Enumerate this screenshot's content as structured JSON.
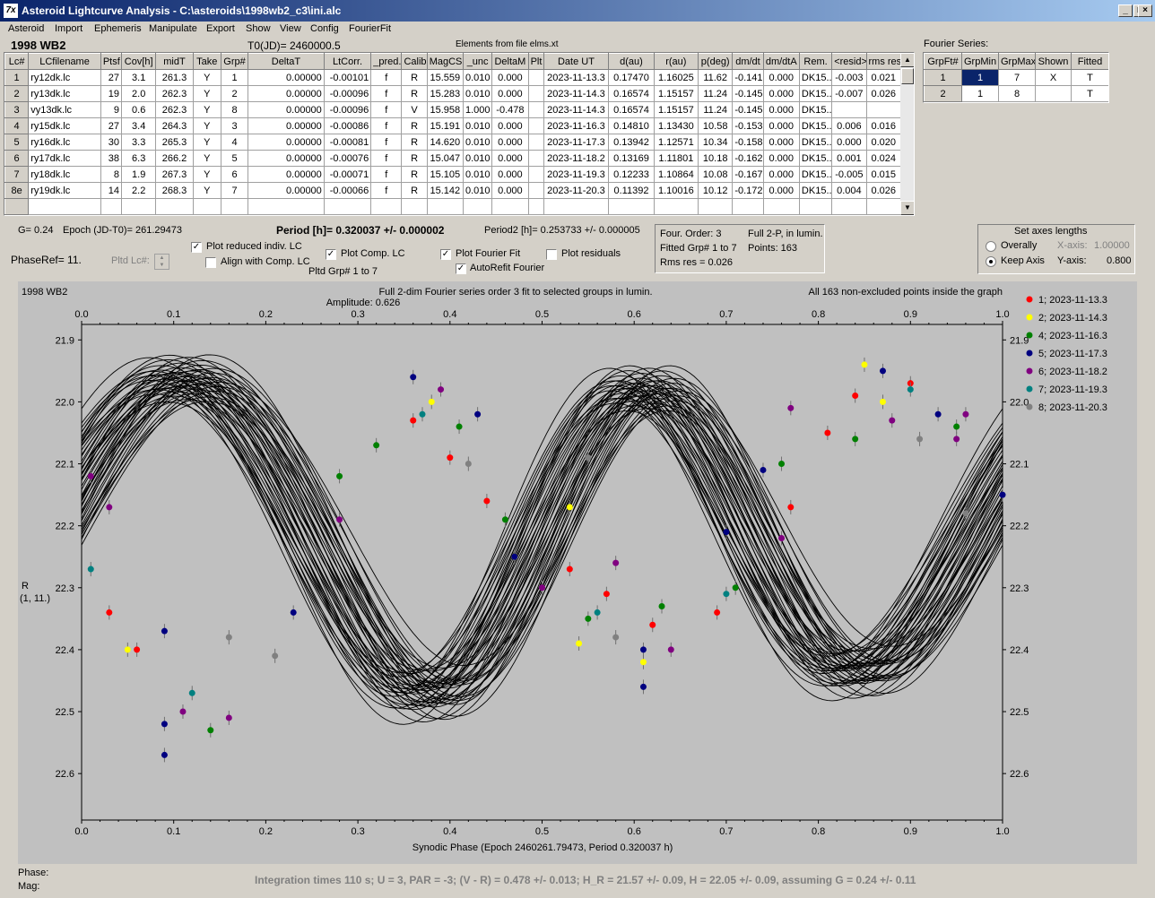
{
  "window": {
    "title": "Asteroid Lightcurve Analysis - C:\\asteroids\\1998wb2_c3\\ini.alc",
    "app_icon": "7x"
  },
  "menu": [
    "Asteroid",
    "Import",
    "Ephemeris",
    "Manipulate",
    "Export",
    "Show",
    "View",
    "Config",
    "FourierFit"
  ],
  "header": {
    "asteroid": "1998 WB2",
    "t0": "T0(JD)= 2460000.5",
    "elements": "Elements from file elms.xt",
    "fourier_label": "Fourier Series:"
  },
  "lc_table": {
    "columns": [
      "Lc#",
      "LCfilename",
      "Ptsf",
      "Cov[h]",
      "midT",
      "Take",
      "Grp#",
      "DeltaT",
      "LtCorr.",
      "_pred.",
      "Calib.",
      "MagCS",
      "_unc",
      "DeltaM",
      "Plt",
      "Date UT",
      "d(au)",
      "r(au)",
      "p(deg)",
      "dm/dt",
      "dm/dtA",
      "Rem.",
      "<resid>",
      "rms res"
    ],
    "rows": [
      [
        "1",
        "ry12dk.lc",
        "27",
        "3.1",
        "261.3",
        "Y",
        "1",
        "0.00000",
        "-0.00101",
        "f",
        "R",
        "15.559",
        "0.010",
        "0.000",
        "",
        "2023-11-13.3",
        "0.17470",
        "1.16025",
        "11.62",
        "-0.141",
        "0.000",
        "DK15...",
        "-0.003",
        "0.021"
      ],
      [
        "2",
        "ry13dk.lc",
        "19",
        "2.0",
        "262.3",
        "Y",
        "2",
        "0.00000",
        "-0.00096",
        "f",
        "R",
        "15.283",
        "0.010",
        "0.000",
        "",
        "2023-11-14.3",
        "0.16574",
        "1.15157",
        "11.24",
        "-0.145",
        "0.000",
        "DK15...",
        "-0.007",
        "0.026"
      ],
      [
        "3",
        "vy13dk.lc",
        "9",
        "0.6",
        "262.3",
        "Y",
        "8",
        "0.00000",
        "-0.00096",
        "f",
        "V",
        "15.958",
        "1.000",
        "-0.478",
        "",
        "2023-11-14.3",
        "0.16574",
        "1.15157",
        "11.24",
        "-0.145",
        "0.000",
        "DK15...",
        "",
        ""
      ],
      [
        "4",
        "ry15dk.lc",
        "27",
        "3.4",
        "264.3",
        "Y",
        "3",
        "0.00000",
        "-0.00086",
        "f",
        "R",
        "15.191",
        "0.010",
        "0.000",
        "",
        "2023-11-16.3",
        "0.14810",
        "1.13430",
        "10.58",
        "-0.153",
        "0.000",
        "DK15...",
        "0.006",
        "0.016"
      ],
      [
        "5",
        "ry16dk.lc",
        "30",
        "3.3",
        "265.3",
        "Y",
        "4",
        "0.00000",
        "-0.00081",
        "f",
        "R",
        "14.620",
        "0.010",
        "0.000",
        "",
        "2023-11-17.3",
        "0.13942",
        "1.12571",
        "10.34",
        "-0.158",
        "0.000",
        "DK15...",
        "0.000",
        "0.020"
      ],
      [
        "6",
        "ry17dk.lc",
        "38",
        "6.3",
        "266.2",
        "Y",
        "5",
        "0.00000",
        "-0.00076",
        "f",
        "R",
        "15.047",
        "0.010",
        "0.000",
        "",
        "2023-11-18.2",
        "0.13169",
        "1.11801",
        "10.18",
        "-0.162",
        "0.000",
        "DK15...",
        "0.001",
        "0.024"
      ],
      [
        "7",
        "ry18dk.lc",
        "8",
        "1.9",
        "267.3",
        "Y",
        "6",
        "0.00000",
        "-0.00071",
        "f",
        "R",
        "15.105",
        "0.010",
        "0.000",
        "",
        "2023-11-19.3",
        "0.12233",
        "1.10864",
        "10.08",
        "-0.167",
        "0.000",
        "DK15...",
        "-0.005",
        "0.015"
      ],
      [
        "8e",
        "ry19dk.lc",
        "14",
        "2.2",
        "268.3",
        "Y",
        "7",
        "0.00000",
        "-0.00066",
        "f",
        "R",
        "15.142",
        "0.010",
        "0.000",
        "",
        "2023-11-20.3",
        "0.11392",
        "1.10016",
        "10.12",
        "-0.172",
        "0.000",
        "DK15...",
        "0.004",
        "0.026"
      ]
    ]
  },
  "fourier_table": {
    "columns": [
      "GrpFt#",
      "GrpMin",
      "GrpMax",
      "Shown",
      "Fitted"
    ],
    "rows": [
      [
        "1",
        "1",
        "7",
        "X",
        "T"
      ],
      [
        "2",
        "1",
        "8",
        "",
        "T"
      ]
    ]
  },
  "info": {
    "g": "G= 0.24",
    "epoch": "Epoch (JD-T0)= 261.29473",
    "period": "Period [h]= 0.320037 +/- 0.000002",
    "period2": "Period2 [h]= 0.253733 +/- 0.000005",
    "phaseref": "PhaseRef= 11.",
    "pltd_lc": "Pltd Lc#:",
    "pltd_grp": "Pltd Grp#  1   to   7"
  },
  "options": {
    "plot_reduced": "Plot reduced indiv. LC",
    "align_comp": "Align with Comp. LC",
    "plot_comp": "Plot Comp. LC",
    "plot_fourier": "Plot Fourier Fit",
    "autorefit": "AutoRefit Fourier",
    "plot_residuals": "Plot residuals"
  },
  "fit_box": {
    "order": "Four. Order:  3",
    "full2p": "Full 2-P, in lumin.",
    "fitted": "Fitted Grp# 1 to 7",
    "points": "Points: 163",
    "rms": "Rms res     = 0.026"
  },
  "axes_box": {
    "title": "Set axes lengths",
    "overally": "Overally",
    "keep": "Keep Axis",
    "xlabel": "X-axis:",
    "xval": "1.00000",
    "ylabel": "Y-axis:",
    "yval": "0.800"
  },
  "plot": {
    "object": "1998 WB2",
    "title": "Full 2-dim Fourier series order 3 fit to selected groups in lumin.",
    "amplitude": "Amplitude: 0.626",
    "note": "All 163 non-excluded points inside the graph",
    "xaxis_label": "Synodic Phase (Epoch 2460261.79473, Period 0.320037 h)",
    "yaxis_label": "R",
    "yaxis_sub": "(1, 11.)"
  },
  "chart_data": {
    "type": "scatter",
    "xlabel": "Synodic Phase (Epoch 2460261.79473, Period 0.320037 h)",
    "ylabel": "R",
    "xlim": [
      0,
      1
    ],
    "ylim": [
      22.675,
      21.875
    ],
    "x_ticks": [
      "0.0",
      "0.1",
      "0.2",
      "0.3",
      "0.4",
      "0.5",
      "0.6",
      "0.7",
      "0.8",
      "0.9",
      "1.0"
    ],
    "y_ticks": [
      "21.9",
      "22.0",
      "22.1",
      "22.2",
      "22.3",
      "22.4",
      "22.5",
      "22.6"
    ],
    "legend_position": "right",
    "series": [
      {
        "name": "1; 2023-11-13.3",
        "color": "#ff0000",
        "points": [
          [
            0.03,
            22.34
          ],
          [
            0.06,
            22.4
          ],
          [
            0.36,
            22.03
          ],
          [
            0.4,
            22.09
          ],
          [
            0.44,
            22.16
          ],
          [
            0.53,
            22.27
          ],
          [
            0.57,
            22.31
          ],
          [
            0.62,
            22.36
          ],
          [
            0.69,
            22.34
          ],
          [
            0.77,
            22.17
          ],
          [
            0.81,
            22.05
          ],
          [
            0.84,
            21.99
          ],
          [
            0.9,
            21.97
          ]
        ]
      },
      {
        "name": "2; 2023-11-14.3",
        "color": "#ffff00",
        "points": [
          [
            0.05,
            22.4
          ],
          [
            0.38,
            22.0
          ],
          [
            0.47,
            22.25
          ],
          [
            0.53,
            22.17
          ],
          [
            0.54,
            22.39
          ],
          [
            0.61,
            22.42
          ],
          [
            0.85,
            21.94
          ],
          [
            0.87,
            22.0
          ]
        ]
      },
      {
        "name": "4; 2023-11-16.3",
        "color": "#008000",
        "points": [
          [
            0.14,
            22.53
          ],
          [
            0.28,
            22.12
          ],
          [
            0.32,
            22.07
          ],
          [
            0.41,
            22.04
          ],
          [
            0.46,
            22.19
          ],
          [
            0.55,
            22.35
          ],
          [
            0.63,
            22.33
          ],
          [
            0.71,
            22.3
          ],
          [
            0.76,
            22.1
          ],
          [
            0.84,
            22.06
          ],
          [
            0.95,
            22.04
          ]
        ]
      },
      {
        "name": "5; 2023-11-17.3",
        "color": "#000080",
        "points": [
          [
            0.09,
            22.37
          ],
          [
            0.09,
            22.57
          ],
          [
            0.09,
            22.52
          ],
          [
            0.23,
            22.34
          ],
          [
            0.36,
            21.96
          ],
          [
            0.43,
            22.02
          ],
          [
            0.47,
            22.25
          ],
          [
            0.61,
            22.4
          ],
          [
            0.61,
            22.46
          ],
          [
            0.7,
            22.21
          ],
          [
            0.74,
            22.11
          ],
          [
            0.87,
            21.95
          ],
          [
            0.93,
            22.02
          ],
          [
            1.0,
            22.15
          ]
        ]
      },
      {
        "name": "6; 2023-11-18.2",
        "color": "#800080",
        "points": [
          [
            0.01,
            22.12
          ],
          [
            0.03,
            22.17
          ],
          [
            0.11,
            22.5
          ],
          [
            0.16,
            22.51
          ],
          [
            0.28,
            22.19
          ],
          [
            0.39,
            21.98
          ],
          [
            0.5,
            22.3
          ],
          [
            0.58,
            22.26
          ],
          [
            0.64,
            22.4
          ],
          [
            0.76,
            22.22
          ],
          [
            0.77,
            22.01
          ],
          [
            0.88,
            22.03
          ],
          [
            0.96,
            22.02
          ],
          [
            0.95,
            22.06
          ]
        ]
      },
      {
        "name": "7; 2023-11-19.3",
        "color": "#008080",
        "points": [
          [
            0.01,
            22.27
          ],
          [
            0.12,
            22.47
          ],
          [
            0.37,
            22.02
          ],
          [
            0.56,
            22.34
          ],
          [
            0.7,
            22.31
          ],
          [
            0.9,
            21.98
          ]
        ]
      },
      {
        "name": "8; 2023-11-20.3",
        "color": "#808080",
        "points": [
          [
            0.16,
            22.38
          ],
          [
            0.21,
            22.41
          ],
          [
            0.42,
            22.1
          ],
          [
            0.55,
            22.09
          ],
          [
            0.58,
            22.38
          ],
          [
            0.91,
            22.06
          ],
          [
            0.96,
            22.18
          ]
        ]
      }
    ]
  },
  "status": {
    "phase": "Phase:",
    "mag": "Mag:",
    "integration": "Integration times 110 s; U = 3, PAR = -3; (V - R) = 0.478 +/- 0.013; H_R = 21.57 +/- 0.09, H = 22.05 +/- 0.09, assuming G = 0.24 +/- 0.11"
  }
}
